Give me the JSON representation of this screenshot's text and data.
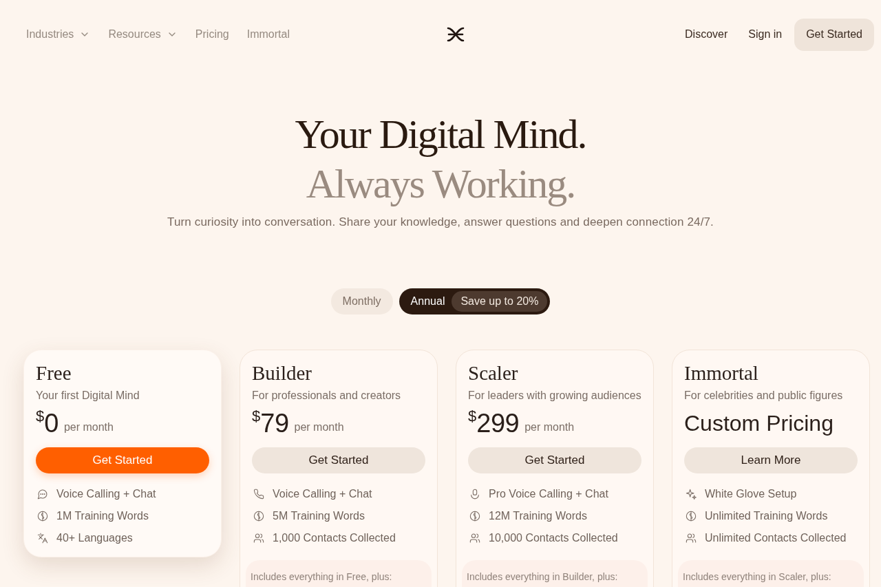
{
  "nav": {
    "left_links": [
      {
        "label": "Industries",
        "has_menu": true
      },
      {
        "label": "Resources",
        "has_menu": true
      },
      {
        "label": "Pricing",
        "has_menu": false
      },
      {
        "label": "Immortal",
        "has_menu": false
      }
    ],
    "right_items": [
      {
        "kind": "link",
        "label": "Discover"
      },
      {
        "kind": "link",
        "label": "Sign in"
      },
      {
        "kind": "button",
        "label": "Get Started"
      }
    ]
  },
  "hero": {
    "title": "Your Digital Mind.",
    "title_secondary": "Always Working.",
    "subtitle": "Turn curiosity into conversation. Share your knowledge, answer questions and deepen connection 24/7."
  },
  "billing_toggle": [
    {
      "label": "Monthly",
      "selected": false
    },
    {
      "label": "Annual",
      "selected": true,
      "badge": "Save up to 20%"
    }
  ],
  "plans": [
    {
      "name": "Free",
      "tagline": "Your first Digital Mind",
      "featured": true,
      "price": {
        "kind": "amount",
        "currency": "$",
        "amount": "0",
        "period": "per month"
      },
      "button": "Get Started",
      "features": [
        {
          "kind": "chat",
          "label": "Voice Calling + Chat"
        },
        {
          "kind": "words",
          "label": "1M Training Words"
        },
        {
          "kind": "languages",
          "label": "40+ Languages"
        }
      ]
    },
    {
      "name": "Builder",
      "tagline": "For professionals and creators",
      "featured": false,
      "price": {
        "kind": "amount",
        "currency": "$",
        "amount": "79",
        "period": "per month"
      },
      "button": "Get Started",
      "features": [
        {
          "kind": "phone",
          "label": "Voice Calling + Chat"
        },
        {
          "kind": "words",
          "label": "5M Training Words"
        },
        {
          "kind": "contacts",
          "label": "1,000 Contacts Collected"
        }
      ],
      "includes": "Includes everything in Free, plus:"
    },
    {
      "name": "Scaler",
      "tagline": "For leaders with growing audiences",
      "featured": false,
      "price": {
        "kind": "amount",
        "currency": "$",
        "amount": "299",
        "period": "per month"
      },
      "button": "Get Started",
      "features": [
        {
          "kind": "voice",
          "label": "Pro Voice Calling + Chat"
        },
        {
          "kind": "words",
          "label": "12M Training Words"
        },
        {
          "kind": "contacts",
          "label": "10,000 Contacts Collected"
        }
      ],
      "includes": "Includes everything in Builder, plus:"
    },
    {
      "name": "Immortal",
      "tagline": "For celebrities and public figures",
      "featured": false,
      "price": {
        "kind": "custom",
        "text": "Custom Pricing"
      },
      "button": "Learn More",
      "features": [
        {
          "kind": "setup",
          "label": "White Glove Setup"
        },
        {
          "kind": "words",
          "label": "Unlimited Training Words"
        },
        {
          "kind": "contacts",
          "label": "Unlimited Contacts Collected"
        }
      ],
      "includes": "Includes everything in Scaler, plus:"
    }
  ]
}
